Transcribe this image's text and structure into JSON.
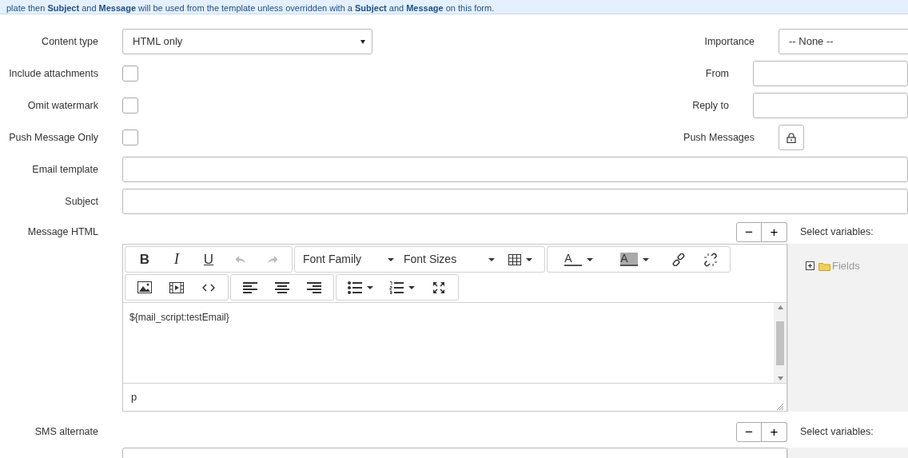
{
  "banner": {
    "text": "plate then **Subject** and **Message** will be used from the template unless overridden with a **Subject** and **Message** on this form."
  },
  "left_fields": [
    {
      "kind": "select",
      "label": "Content type",
      "value": "HTML only"
    },
    {
      "kind": "checkbox",
      "label": "Include attachments",
      "checked": false
    },
    {
      "kind": "checkbox",
      "label": "Omit watermark",
      "checked": false
    },
    {
      "kind": "checkbox",
      "label": "Push Message Only",
      "checked": false
    }
  ],
  "right_fields": [
    {
      "kind": "select",
      "label": "Importance",
      "value": "-- None --"
    },
    {
      "kind": "text",
      "label": "From"
    },
    {
      "kind": "text",
      "label": "Reply to"
    },
    {
      "kind": "lock",
      "label": "Push Messages"
    }
  ],
  "wide_fields": [
    {
      "label": "Email template"
    },
    {
      "label": "Subject"
    }
  ],
  "message_html": {
    "label": "Message HTML",
    "zoom_buttons": [
      "−",
      "+"
    ],
    "variables_label": "Select variables:",
    "toolbar": [
      [
        [
          {
            "kind": "bold",
            "text": "B",
            "disabled": false
          },
          {
            "kind": "italic",
            "text": "I",
            "disabled": false
          },
          {
            "kind": "underline",
            "text": "U",
            "disabled": false
          },
          {
            "kind": "undo",
            "disabled": true
          },
          {
            "kind": "redo",
            "disabled": true
          }
        ],
        [
          {
            "kind": "listbox",
            "text": "Font Family",
            "disabled": false
          },
          {
            "kind": "listbox",
            "text": "Font Sizes",
            "disabled": false
          },
          {
            "kind": "table",
            "disabled": false
          }
        ],
        [
          {
            "kind": "forecolor",
            "text": "A",
            "disabled": false
          },
          {
            "kind": "backcolor",
            "text": "A",
            "disabled": false
          },
          {
            "kind": "link",
            "disabled": false
          },
          {
            "kind": "unlink",
            "disabled": false
          }
        ]
      ],
      [
        [
          {
            "kind": "image",
            "disabled": false
          },
          {
            "kind": "media",
            "disabled": false
          },
          {
            "kind": "code",
            "disabled": false
          }
        ],
        [
          {
            "kind": "align-left",
            "disabled": false
          },
          {
            "kind": "align-center",
            "disabled": false
          },
          {
            "kind": "align-right",
            "disabled": false
          }
        ],
        [
          {
            "kind": "bullist",
            "disabled": false
          },
          {
            "kind": "numlist",
            "disabled": false
          },
          {
            "kind": "fullscreen",
            "disabled": false
          }
        ]
      ]
    ],
    "content": "${mail_script:testEmail}",
    "path": "p",
    "variables": [
      {
        "label": "Fields",
        "expanded": false
      }
    ]
  },
  "sms_alternate": {
    "label": "SMS alternate",
    "zoom_buttons": [
      "−",
      "+"
    ],
    "variables_label": "Select variables:"
  }
}
